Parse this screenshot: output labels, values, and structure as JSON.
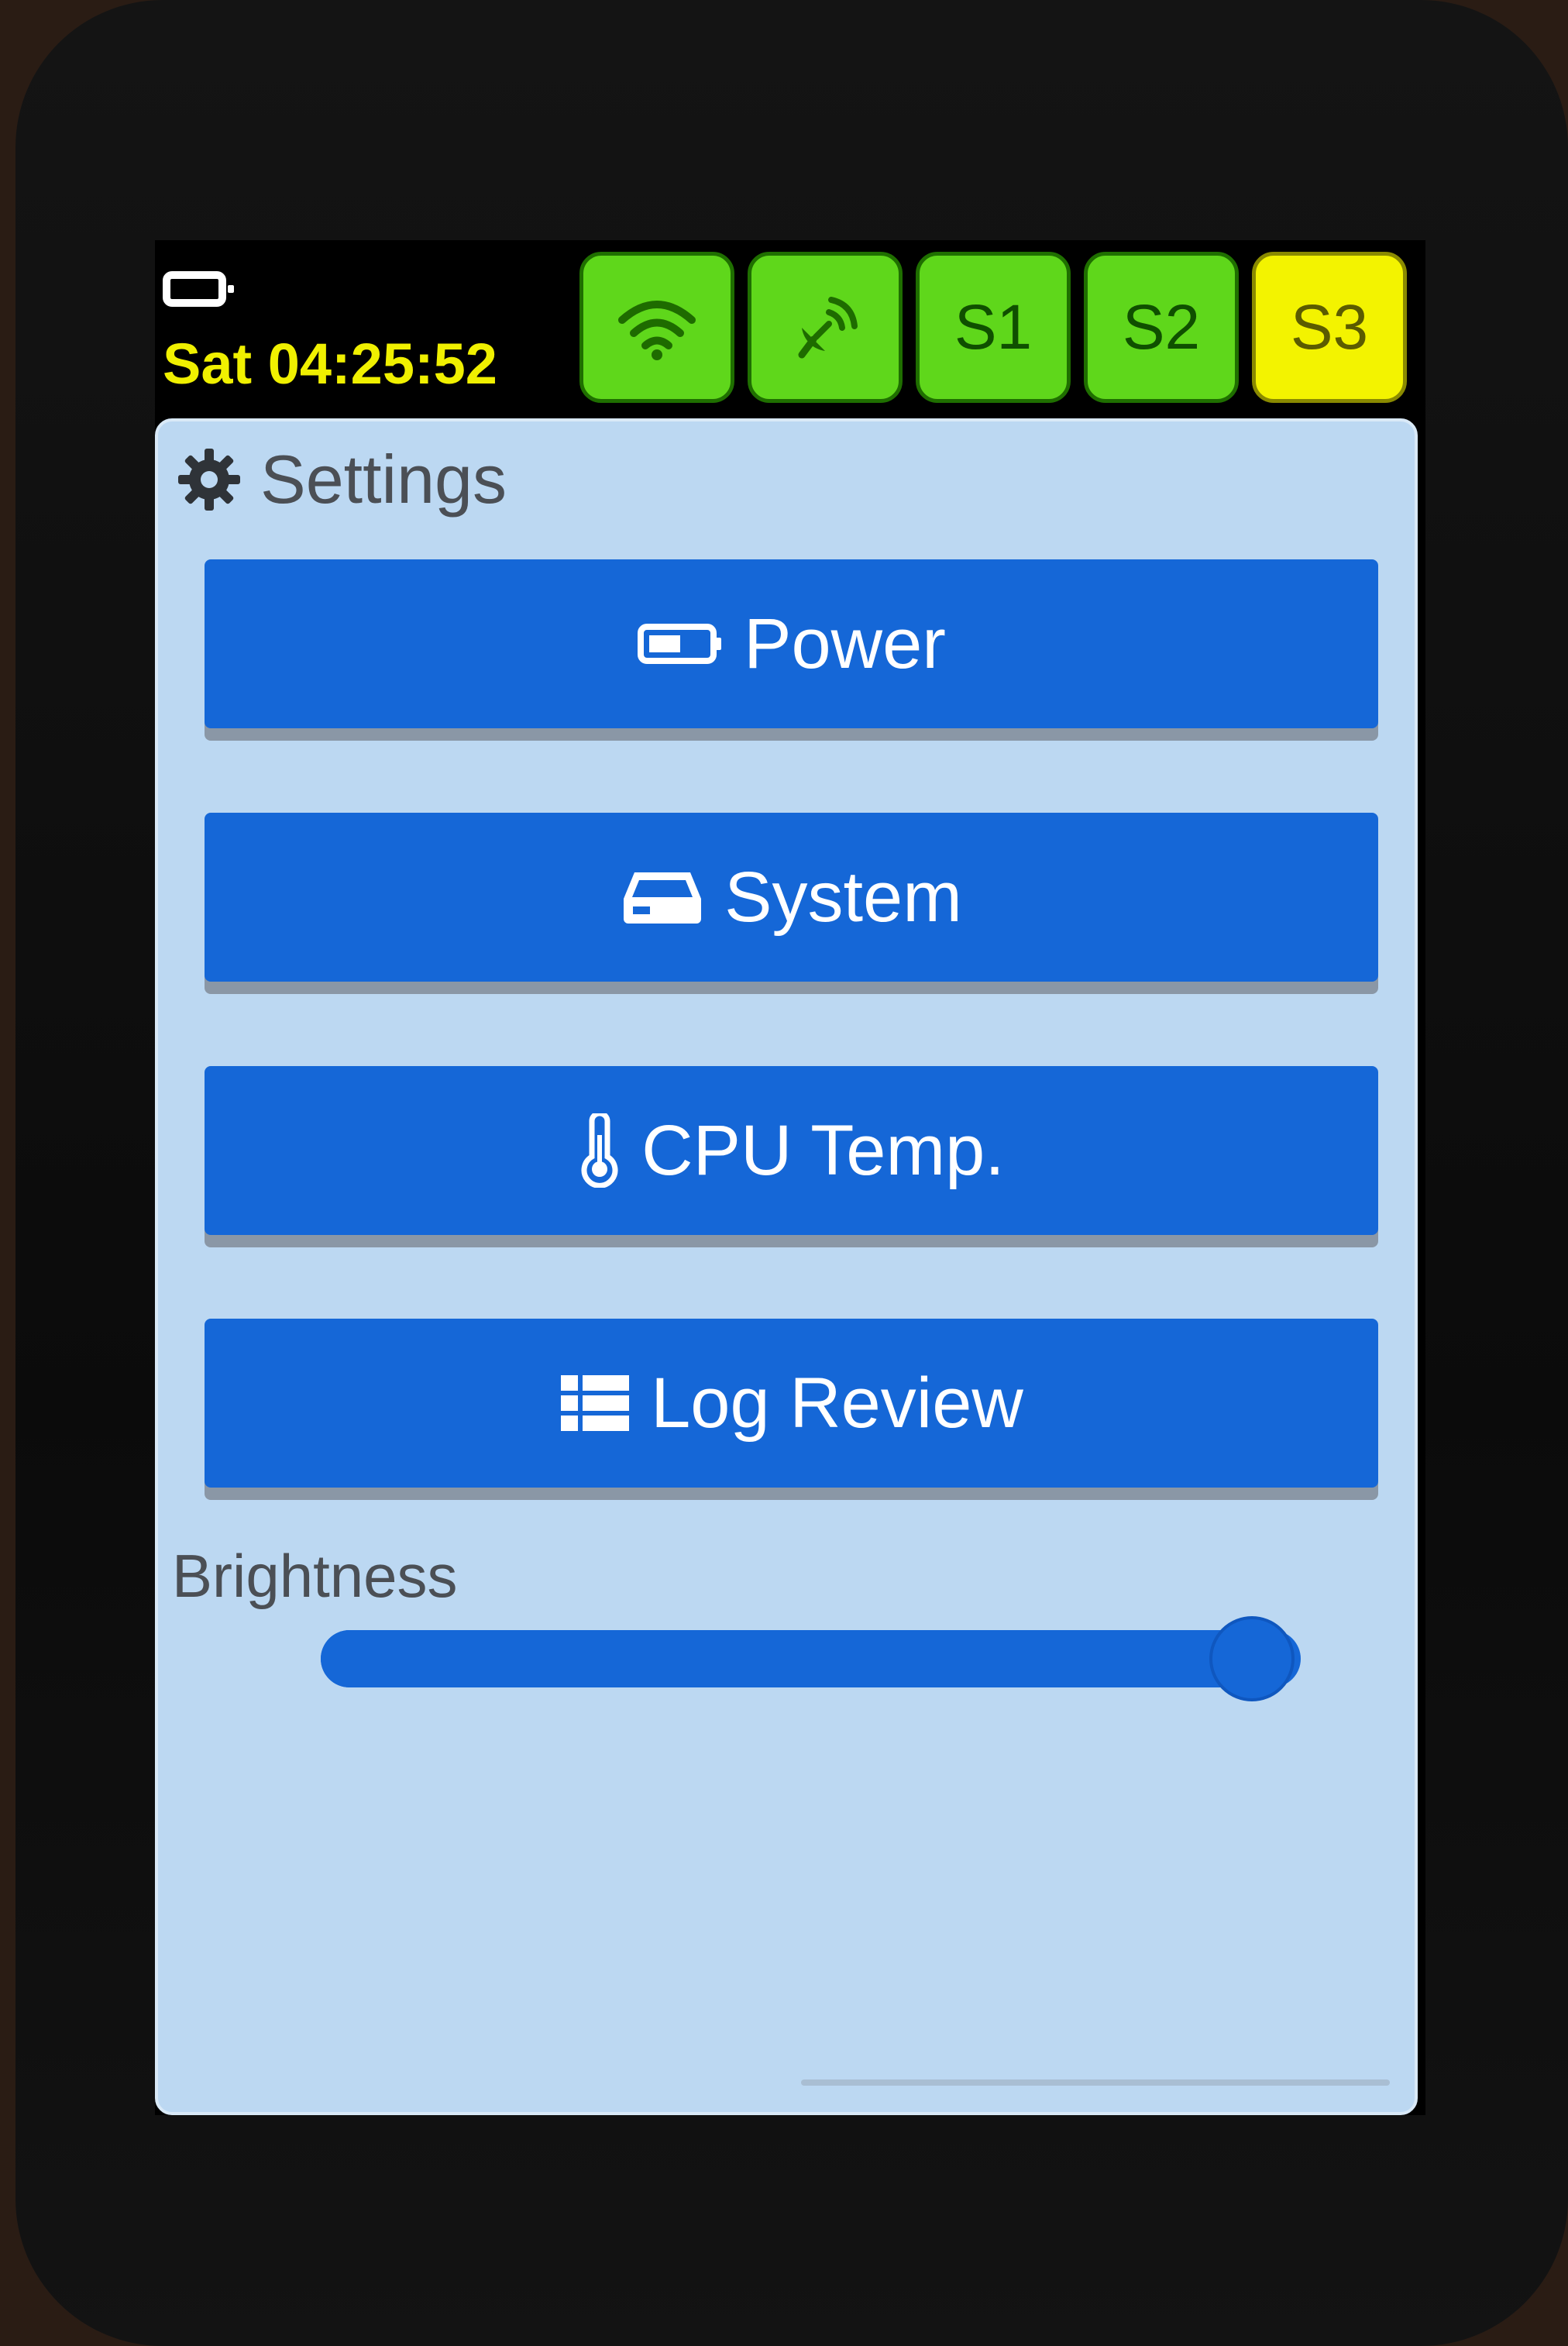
{
  "status_bar": {
    "clock": "Sat 04:25:52",
    "battery_icon": "battery-icon",
    "tiles": [
      {
        "name": "wifi",
        "icon": "wifi-icon",
        "label": "",
        "state": "ok",
        "color": "#5fd71b"
      },
      {
        "name": "satellite",
        "icon": "satellite-icon",
        "label": "",
        "state": "ok",
        "color": "#5fd71b"
      },
      {
        "name": "s1",
        "icon": "",
        "label": "S1",
        "state": "ok",
        "color": "#5fd71b"
      },
      {
        "name": "s2",
        "icon": "",
        "label": "S2",
        "state": "ok",
        "color": "#5fd71b"
      },
      {
        "name": "s3",
        "icon": "",
        "label": "S3",
        "state": "warning",
        "color": "#f3f300"
      }
    ]
  },
  "settings": {
    "title": "Settings",
    "title_icon": "gear-icon",
    "buttons": [
      {
        "label": "Power",
        "icon": "battery-icon"
      },
      {
        "label": "System",
        "icon": "drive-icon"
      },
      {
        "label": "CPU Temp.",
        "icon": "thermometer-icon"
      },
      {
        "label": "Log Review",
        "icon": "list-icon"
      }
    ],
    "brightness": {
      "label": "Brightness",
      "value_fraction": 0.95
    }
  },
  "colors": {
    "accent": "#1567d7",
    "panel_bg": "#bcd8f2",
    "clock": "#f0f000",
    "ok": "#5fd71b",
    "warning": "#f3f300"
  }
}
